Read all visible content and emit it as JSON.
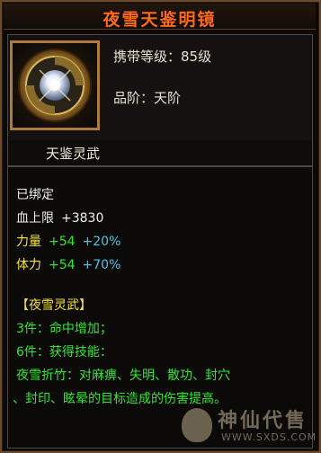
{
  "tooltip": {
    "title": "夜雪天鉴明镜",
    "level_req": "携带等级：85级",
    "grade": "品阶：天阶",
    "subtitle": "天鉴灵武",
    "bound": "已绑定",
    "stats": [
      {
        "name": "血上限",
        "value": "+3830",
        "bonus": ""
      },
      {
        "name": "力量",
        "value": "+54",
        "bonus": "+20%"
      },
      {
        "name": "体力",
        "value": "+54",
        "bonus": "+70%"
      }
    ],
    "set": {
      "name": "【夜雪灵武】",
      "lines": [
        "3件：命中增加；",
        "6件：获得技能：",
        "夜雪折竹：对麻痹、失明、散功、封穴",
        "、封印、眩晕的目标造成的伤害提高。"
      ]
    },
    "icon": "mirror-icon"
  },
  "watermark": {
    "text": "神仙代售",
    "url": "WWW.SXDS.COM"
  },
  "colors": {
    "title": "#ff6a1a",
    "stat_name_white": "#f0f0f0",
    "stat_name_yellow": "#f6e23c",
    "set_green": "#2ee82e",
    "bonus_cyan": "#4ac8e8"
  }
}
